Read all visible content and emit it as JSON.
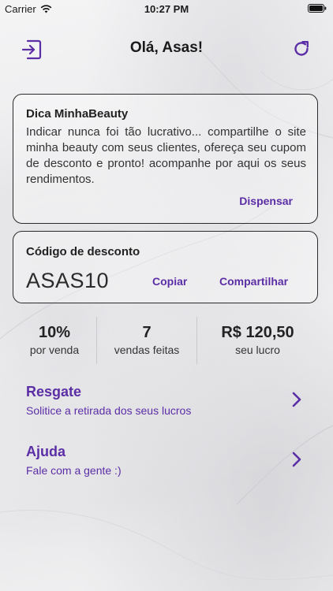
{
  "status_bar": {
    "carrier": "Carrier",
    "time": "10:27 PM"
  },
  "header": {
    "title": "Olá, Asas!"
  },
  "tip_card": {
    "title": "Dica MinhaBeauty",
    "text": "Indicar nunca foi tão lucrativo... compartilhe o site minha beauty com seus clientes, ofereça seu cupom de desconto e pronto! acompanhe por aqui os seus rendimentos.",
    "dismiss_label": "Dispensar"
  },
  "discount_card": {
    "title": "Código de desconto",
    "code": "ASAS10",
    "copy_label": "Copiar",
    "share_label": "Compartilhar"
  },
  "stats": [
    {
      "value": "10%",
      "label": "por venda"
    },
    {
      "value": "7",
      "label": "vendas feitas"
    },
    {
      "value": "R$ 120,50",
      "label": "seu lucro"
    }
  ],
  "menu": [
    {
      "title": "Resgate",
      "subtitle": "Solitice a retirada dos seus lucros"
    },
    {
      "title": "Ajuda",
      "subtitle": "Fale com a gente :)"
    }
  ],
  "icons": {
    "logout": "logout-icon",
    "refresh": "refresh-icon",
    "chevron": "chevron-right-icon",
    "wifi": "wifi-icon",
    "battery": "battery-icon"
  },
  "colors": {
    "accent": "#5b2ea6",
    "border": "#2a2a2a"
  }
}
